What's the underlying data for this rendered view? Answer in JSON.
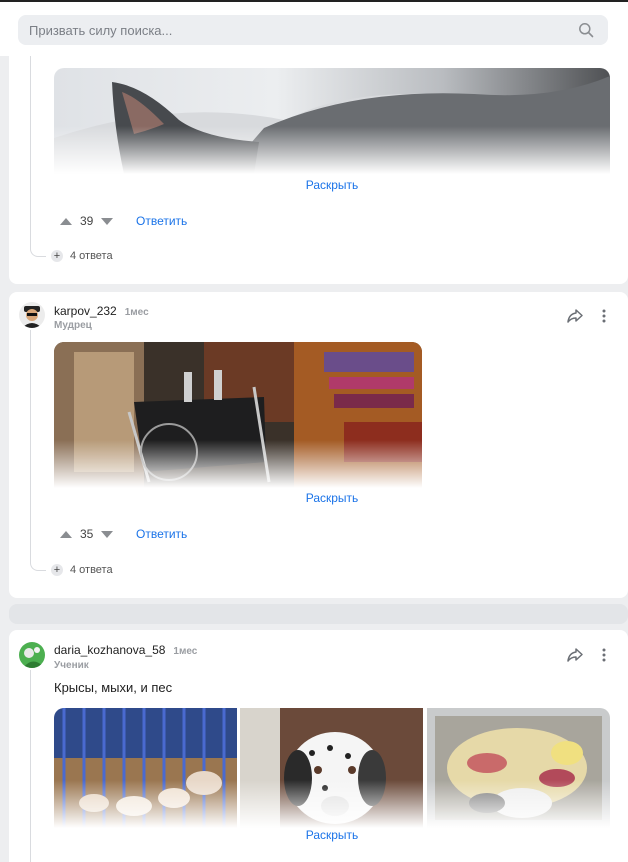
{
  "search": {
    "placeholder": "Призвать силу поиска..."
  },
  "comments": [
    {
      "expand_label": "Раскрыть",
      "votes": "39",
      "reply_label": "Ответить",
      "answers_label": "4 ответа"
    },
    {
      "username": "karpov_232",
      "time": "1мес",
      "rank": "Мудрец",
      "expand_label": "Раскрыть",
      "votes": "35",
      "reply_label": "Ответить",
      "answers_label": "4 ответа"
    },
    {
      "username": "daria_kozhanova_58",
      "time": "1мес",
      "rank": "Ученик",
      "text": "Крысы, мыхи, и пес",
      "expand_label": "Раскрыть"
    }
  ],
  "colors": {
    "link": "#1a73e8",
    "page_bg": "#edeef0",
    "card_bg": "#ffffff"
  },
  "icons": [
    "search-icon",
    "share-icon",
    "more-vertical-icon",
    "upvote-icon",
    "downvote-icon",
    "plus-icon"
  ]
}
